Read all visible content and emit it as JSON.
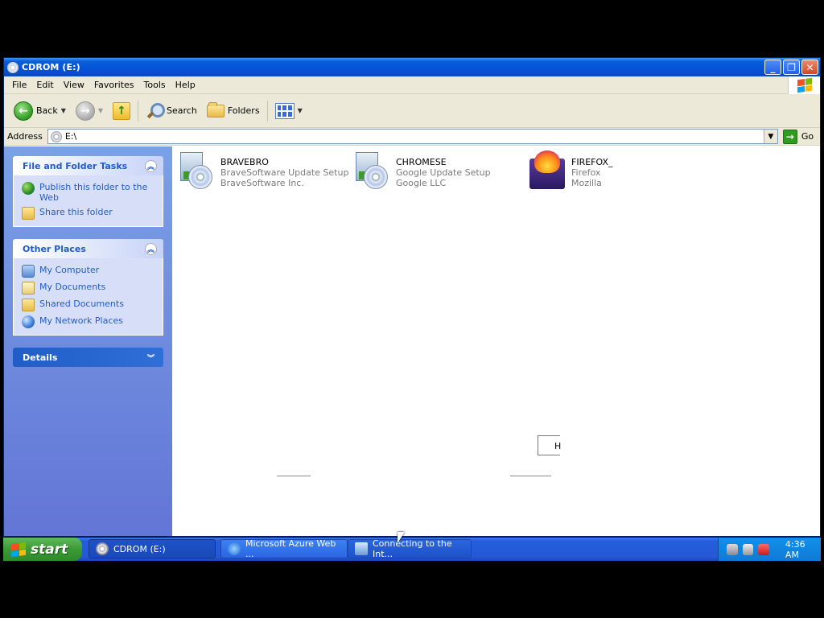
{
  "window": {
    "title": "CDROM (E:)"
  },
  "menubar": {
    "items": [
      "File",
      "Edit",
      "View",
      "Favorites",
      "Tools",
      "Help"
    ]
  },
  "toolbar": {
    "back_label": "Back",
    "search_label": "Search",
    "folders_label": "Folders"
  },
  "address": {
    "label": "Address",
    "value": "E:\\",
    "go_label": "Go"
  },
  "sidebar": {
    "file_tasks": {
      "title": "File and Folder Tasks",
      "items": [
        {
          "label": "Publish this folder to the Web",
          "icon": "globe-icon"
        },
        {
          "label": "Share this folder",
          "icon": "share-folder-icon"
        }
      ]
    },
    "other_places": {
      "title": "Other Places",
      "items": [
        {
          "label": "My Computer",
          "icon": "computer-icon"
        },
        {
          "label": "My Documents",
          "icon": "documents-icon"
        },
        {
          "label": "Shared Documents",
          "icon": "folder-icon"
        },
        {
          "label": "My Network Places",
          "icon": "network-icon"
        }
      ]
    },
    "details": {
      "title": "Details"
    }
  },
  "files": [
    {
      "name": "BRAVEBRO",
      "description": "BraveSoftware Update Setup",
      "company": "BraveSoftware Inc.",
      "icon": "setup-disc-icon"
    },
    {
      "name": "CHROMESE",
      "description": "Google Update Setup",
      "company": "Google LLC",
      "icon": "setup-disc-icon"
    },
    {
      "name": "FIREFOX_",
      "description": "Firefox",
      "company": "Mozilla",
      "icon": "firefox-icon"
    }
  ],
  "artifacts": {
    "box_text": "H"
  },
  "taskbar": {
    "start_label": "start",
    "buttons": [
      {
        "label": "CDROM (E:)"
      },
      {
        "label": "Microsoft Azure Web ..."
      },
      {
        "label": "Connecting to the Int..."
      }
    ],
    "clock": "4:36 AM"
  },
  "colors": {
    "titlebar": "#0453d6",
    "sidebar_bg": "#6375d6",
    "link": "#215dc6",
    "start_green": "#3c9a36"
  }
}
